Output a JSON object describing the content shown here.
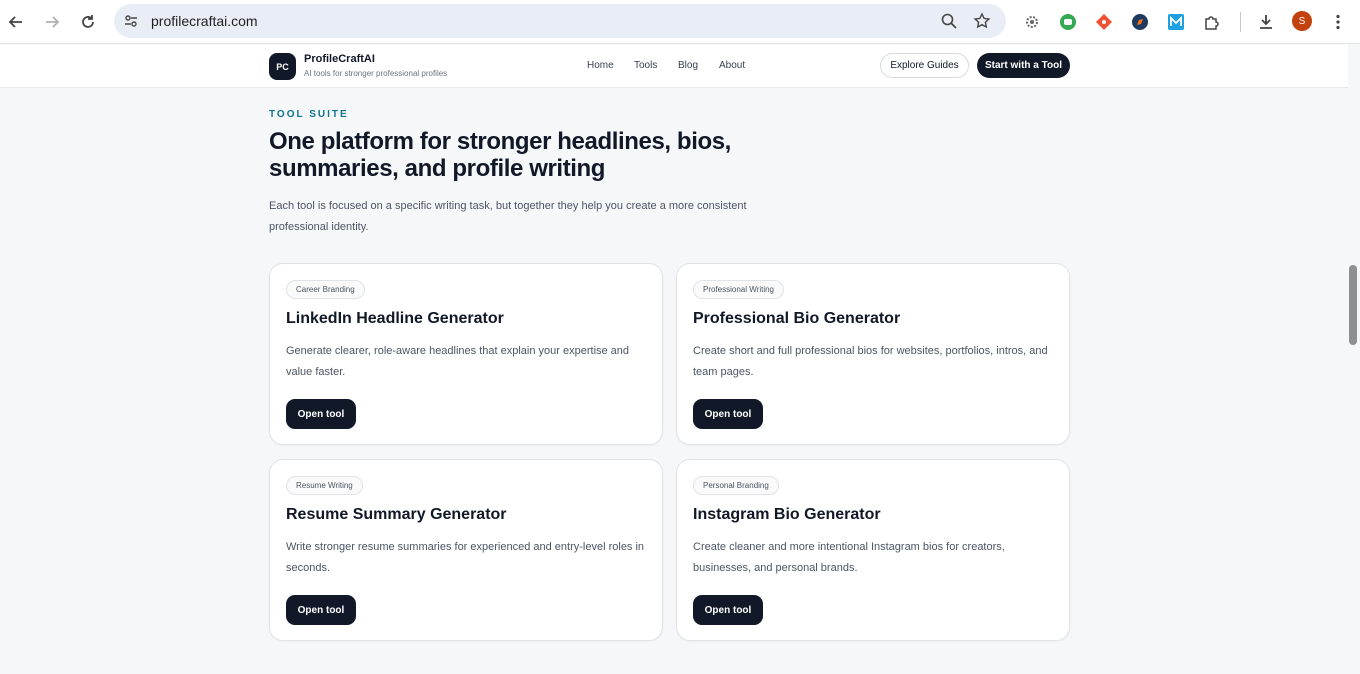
{
  "browser": {
    "url": "profilecraftai.com",
    "avatar_letter": "S",
    "icons": [
      "back-icon",
      "forward-icon",
      "reload-icon",
      "site-settings-icon",
      "zoom-icon",
      "bookmark-star-icon",
      "extension-gear-icon",
      "extension-android-icon",
      "extension-git-icon",
      "extension-compass-icon",
      "extension-m-icon",
      "extensions-puzzle-icon",
      "download-icon",
      "menu-dots-icon"
    ]
  },
  "site": {
    "logo": "PC",
    "brand": "ProfileCraftAI",
    "tagline": "AI tools for stronger professional profiles",
    "nav": [
      "Home",
      "Tools",
      "Blog",
      "About"
    ],
    "explore_button": "Explore Guides",
    "start_button": "Start with a Tool"
  },
  "section": {
    "eyebrow": "TOOL SUITE",
    "headline": "One platform for stronger headlines, bios, summaries, and profile writing",
    "lede": "Each tool is focused on a specific writing task, but together they help you create a more consistent professional identity."
  },
  "cards": [
    {
      "tag": "Career Branding",
      "title": "LinkedIn Headline Generator",
      "desc": "Generate clearer, role-aware headlines that explain your expertise and value faster.",
      "button": "Open tool"
    },
    {
      "tag": "Professional Writing",
      "title": "Professional Bio Generator",
      "desc": "Create short and full professional bios for websites, portfolios, intros, and team pages.",
      "button": "Open tool"
    },
    {
      "tag": "Resume Writing",
      "title": "Resume Summary Generator",
      "desc": "Write stronger resume summaries for experienced and entry-level roles in seconds.",
      "button": "Open tool"
    },
    {
      "tag": "Personal Branding",
      "title": "Instagram Bio Generator",
      "desc": "Create cleaner and more intentional Instagram bios for creators, businesses, and personal brands.",
      "button": "Open tool"
    }
  ]
}
